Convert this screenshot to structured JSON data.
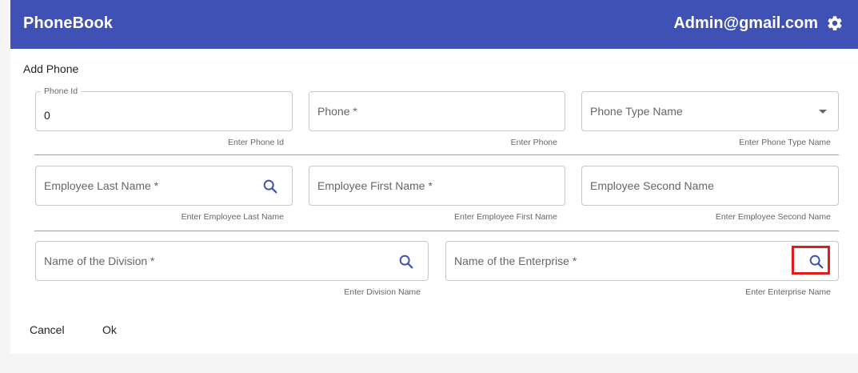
{
  "app": {
    "title": "PhoneBook",
    "user_email": "Admin@gmail.com",
    "accent_color": "#3f51b5"
  },
  "dialog": {
    "title": "Add Phone",
    "fields": {
      "phone_id": {
        "label": "Phone Id",
        "value": "0",
        "hint": "Enter Phone Id"
      },
      "phone": {
        "placeholder": "Phone *",
        "hint": "Enter Phone"
      },
      "phone_type": {
        "placeholder": "Phone Type Name",
        "hint": "Enter Phone Type Name"
      },
      "employee_last": {
        "placeholder": "Employee Last Name *",
        "hint": "Enter Employee Last Name"
      },
      "employee_first": {
        "placeholder": "Employee First Name *",
        "hint": "Enter Employee First Name"
      },
      "employee_second": {
        "placeholder": "Employee Second Name",
        "hint": "Enter Employee Second Name"
      },
      "division": {
        "placeholder": "Name of the Division *",
        "hint": "Enter Division Name"
      },
      "enterprise": {
        "placeholder": "Name of the Enterprise *",
        "hint": "Enter Enterprise Name"
      }
    },
    "actions": {
      "cancel_label": "Cancel",
      "ok_label": "Ok"
    }
  },
  "icons": {
    "settings": "gear-icon",
    "search": "search-icon",
    "dropdown": "caret-down-icon"
  },
  "highlight_color": "#e21b1b"
}
